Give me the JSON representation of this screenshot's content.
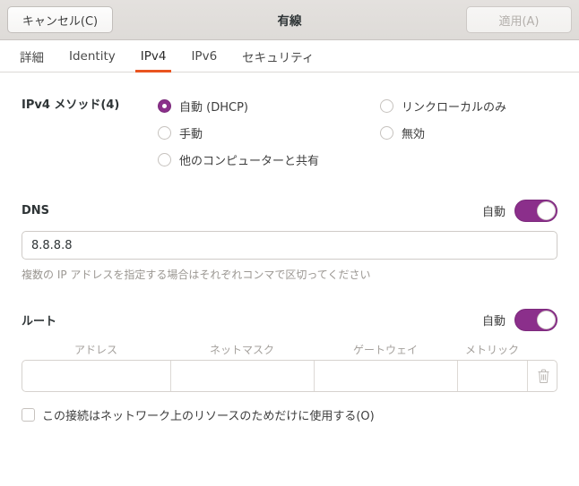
{
  "header": {
    "cancel_label": "キャンセル(C)",
    "title": "有線",
    "apply_label": "適用(A)"
  },
  "tabs": [
    {
      "label": "詳細",
      "name": "tab-details",
      "active": false
    },
    {
      "label": "Identity",
      "name": "tab-identity",
      "active": false
    },
    {
      "label": "IPv4",
      "name": "tab-ipv4",
      "active": true
    },
    {
      "label": "IPv6",
      "name": "tab-ipv6",
      "active": false
    },
    {
      "label": "セキュリティ",
      "name": "tab-security",
      "active": false
    }
  ],
  "method": {
    "label": "IPv4 メソッド(4)",
    "options_left": [
      {
        "label": "自動 (DHCP)",
        "checked": true
      },
      {
        "label": "手動",
        "checked": false
      },
      {
        "label": "他のコンピューターと共有",
        "checked": false
      }
    ],
    "options_right": [
      {
        "label": "リンクローカルのみ",
        "checked": false
      },
      {
        "label": "無効",
        "checked": false
      }
    ]
  },
  "dns": {
    "title": "DNS",
    "auto_label": "自動",
    "auto_on": true,
    "value": "8.8.8.8",
    "placeholder": "",
    "hint": "複数の IP アドレスを指定する場合はそれぞれコンマで区切ってください"
  },
  "routes": {
    "title": "ルート",
    "auto_label": "自動",
    "auto_on": true,
    "columns": [
      "アドレス",
      "ネットマスク",
      "ゲートウェイ",
      "メトリック"
    ],
    "rows": [
      {
        "address": "",
        "netmask": "",
        "gateway": "",
        "metric": ""
      }
    ],
    "delete_icon": "trash-icon"
  },
  "restrict": {
    "label": "この接続はネットワーク上のリソースのためだけに使用する(O)",
    "checked": false
  },
  "colors": {
    "accent_tab": "#e95420",
    "accent_toggle": "#8b2f8b",
    "headerbar_bg": "#dedbd8"
  }
}
